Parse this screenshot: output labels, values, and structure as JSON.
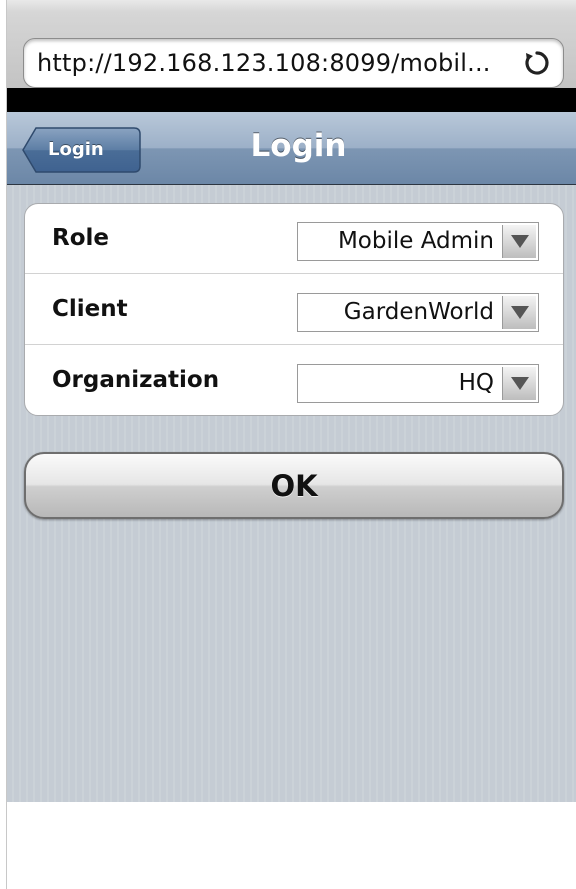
{
  "browser": {
    "url": "http://192.168.123.108:8099/mobil...",
    "reload_icon": "reload-icon"
  },
  "header": {
    "back_label": "Login",
    "title": "Login"
  },
  "form": {
    "rows": [
      {
        "label": "Role",
        "value": "Mobile Admin"
      },
      {
        "label": "Client",
        "value": "GardenWorld"
      },
      {
        "label": "Organization",
        "value": "HQ"
      }
    ]
  },
  "actions": {
    "ok_label": "OK"
  },
  "colors": {
    "header_blue": "#6c87a7",
    "background_stripe": "#c5ccd4"
  }
}
